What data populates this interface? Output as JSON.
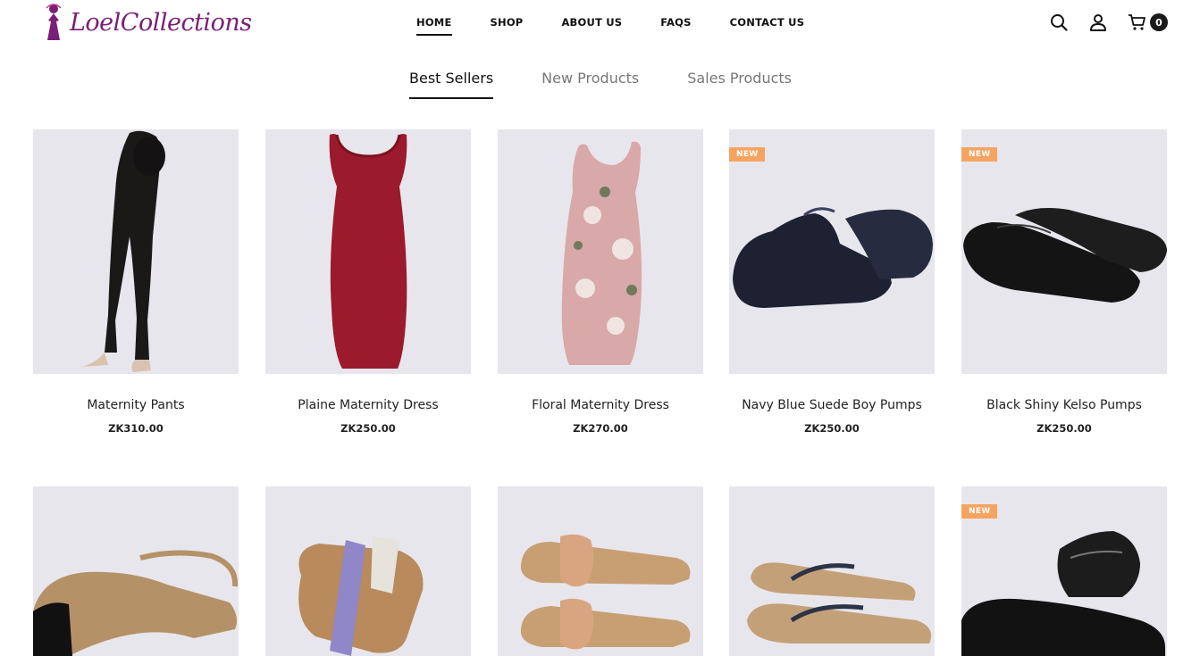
{
  "brand": {
    "name": "LoelCollections"
  },
  "nav": [
    "HOME",
    "SHOP",
    "ABOUT US",
    "FAQS",
    "CONTACT US"
  ],
  "cart": {
    "count": "0"
  },
  "tabs": [
    "Best Sellers",
    "New Products",
    "Sales Products"
  ],
  "products": [
    {
      "name": "Maternity Pants",
      "price": "ZK310.00",
      "badge": ""
    },
    {
      "name": "Plaine Maternity Dress",
      "price": "ZK250.00",
      "badge": ""
    },
    {
      "name": "Floral Maternity Dress",
      "price": "ZK270.00",
      "badge": ""
    },
    {
      "name": "Navy Blue Suede Boy Pumps",
      "price": "ZK250.00",
      "badge": "NEW"
    },
    {
      "name": "Black Shiny Kelso Pumps",
      "price": "ZK250.00",
      "badge": "NEW"
    }
  ],
  "products_row2": [
    {
      "badge": ""
    },
    {
      "badge": ""
    },
    {
      "badge": ""
    },
    {
      "badge": ""
    },
    {
      "badge": "NEW"
    }
  ]
}
